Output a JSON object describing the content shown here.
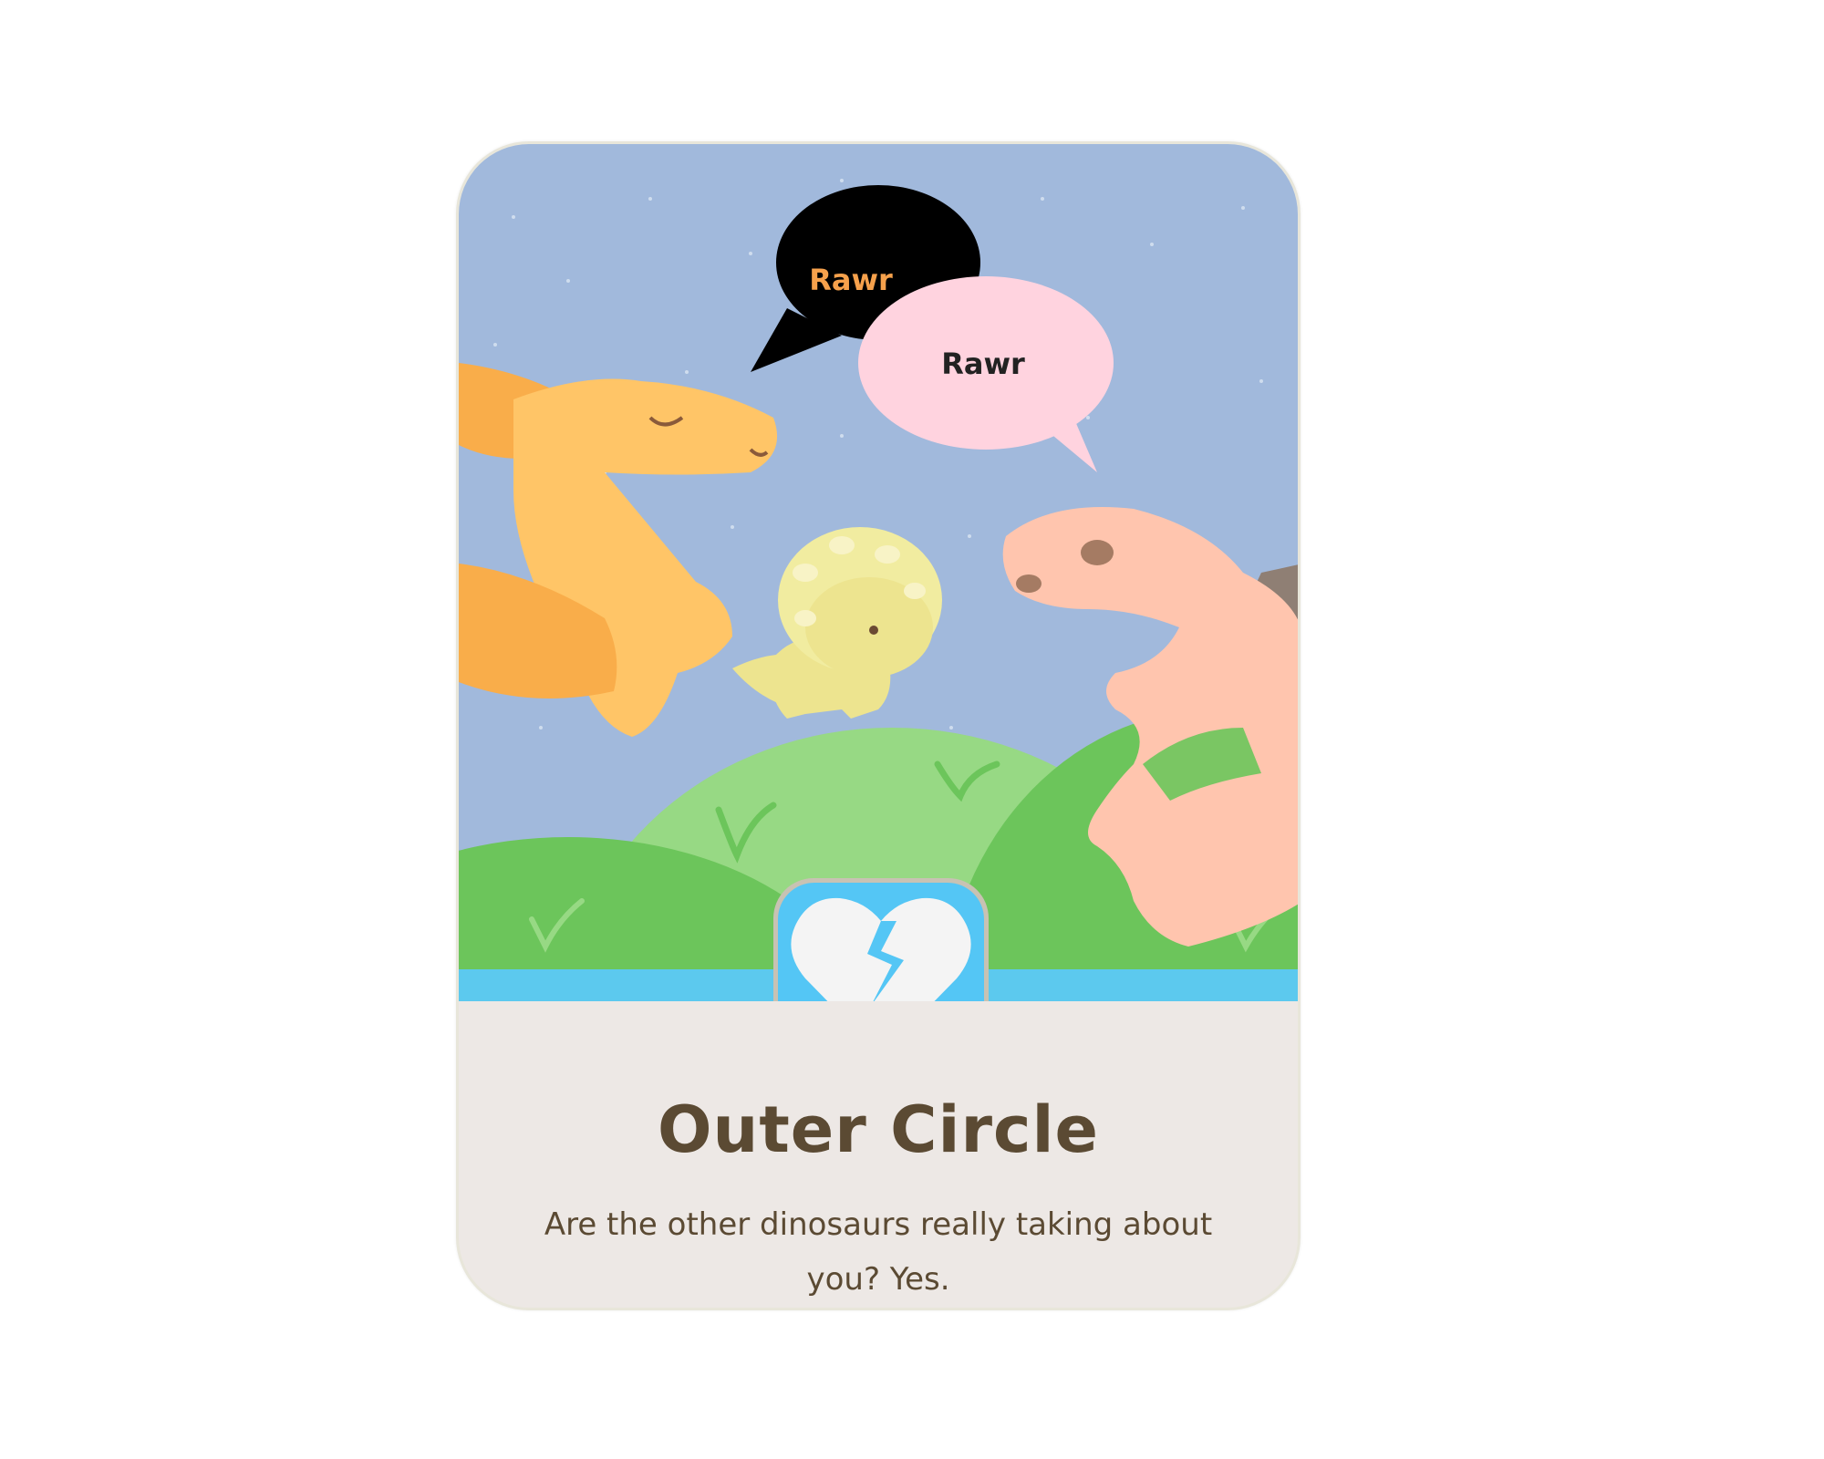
{
  "card": {
    "title": "Outer Circle",
    "description": "Are the other dinosaurs really taking about you? Yes.",
    "category_icon": "broken-heart-icon"
  },
  "speech": {
    "bubble_black": "Rawr",
    "bubble_pink": "Rawr"
  },
  "colors": {
    "sky": "#a1b9dc",
    "grass_dark": "#6cc55b",
    "grass_light": "#97d984",
    "band": "#5cc9ee",
    "icon_tile": "#54c6f5",
    "panel": "#ede8e5",
    "text": "#5b4a33",
    "pterodactyl": "#ffc567",
    "triceratops": "#ede48f",
    "brontosaurus": "#ffc5ae"
  }
}
